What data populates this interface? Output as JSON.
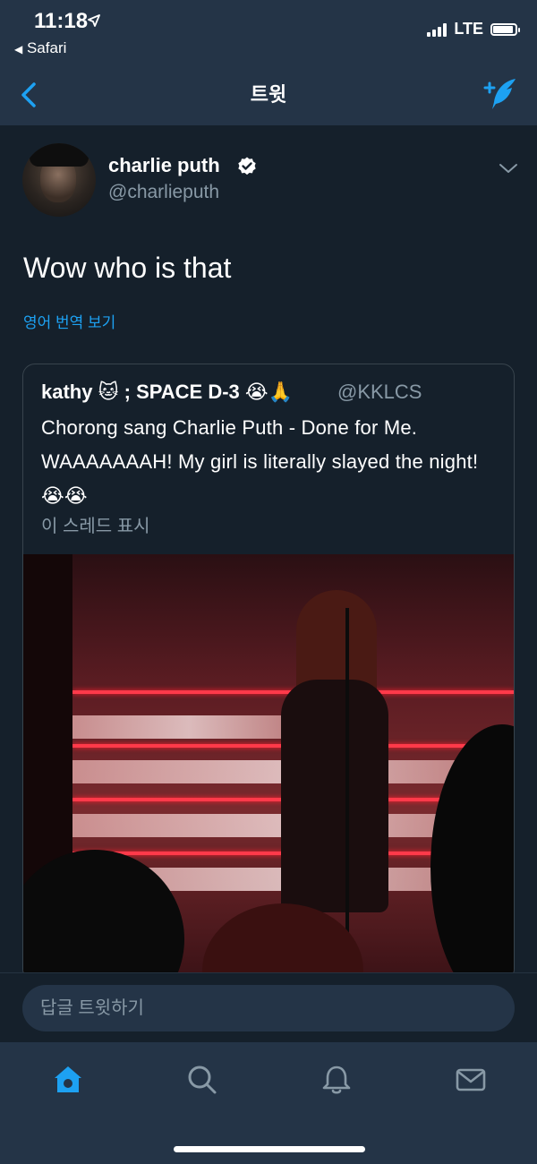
{
  "status_bar": {
    "time": "11:18",
    "back_app": "Safari",
    "network": "LTE",
    "battery_level": 0.9
  },
  "nav": {
    "title": "트윗"
  },
  "tweet": {
    "author_name": "charlie puth",
    "author_handle": "@charlieputh",
    "text": "Wow who is that",
    "translate_label": "영어 번역 보기"
  },
  "quoted_tweet": {
    "author": "kathy 🐱 ; SPACE D-3 😭🙏",
    "handle": "@KKLCS",
    "text": "Chorong sang Charlie Puth - Done for Me. WAAAAAAAH! My girl is literally slayed the night! 😭😭",
    "thread_label": "이 스레드 표시"
  },
  "reply": {
    "placeholder": "답글 트윗하기"
  },
  "colors": {
    "background": "#15202b",
    "bar": "#243447",
    "accent": "#1da1f2",
    "secondary_text": "#8899a6"
  },
  "icons": {
    "back": "chevron-left-icon",
    "compose": "compose-tweet-icon",
    "verified": "verified-badge-icon",
    "more": "chevron-down-icon",
    "tabs": [
      "home-icon",
      "search-icon",
      "notifications-icon",
      "messages-icon"
    ]
  }
}
